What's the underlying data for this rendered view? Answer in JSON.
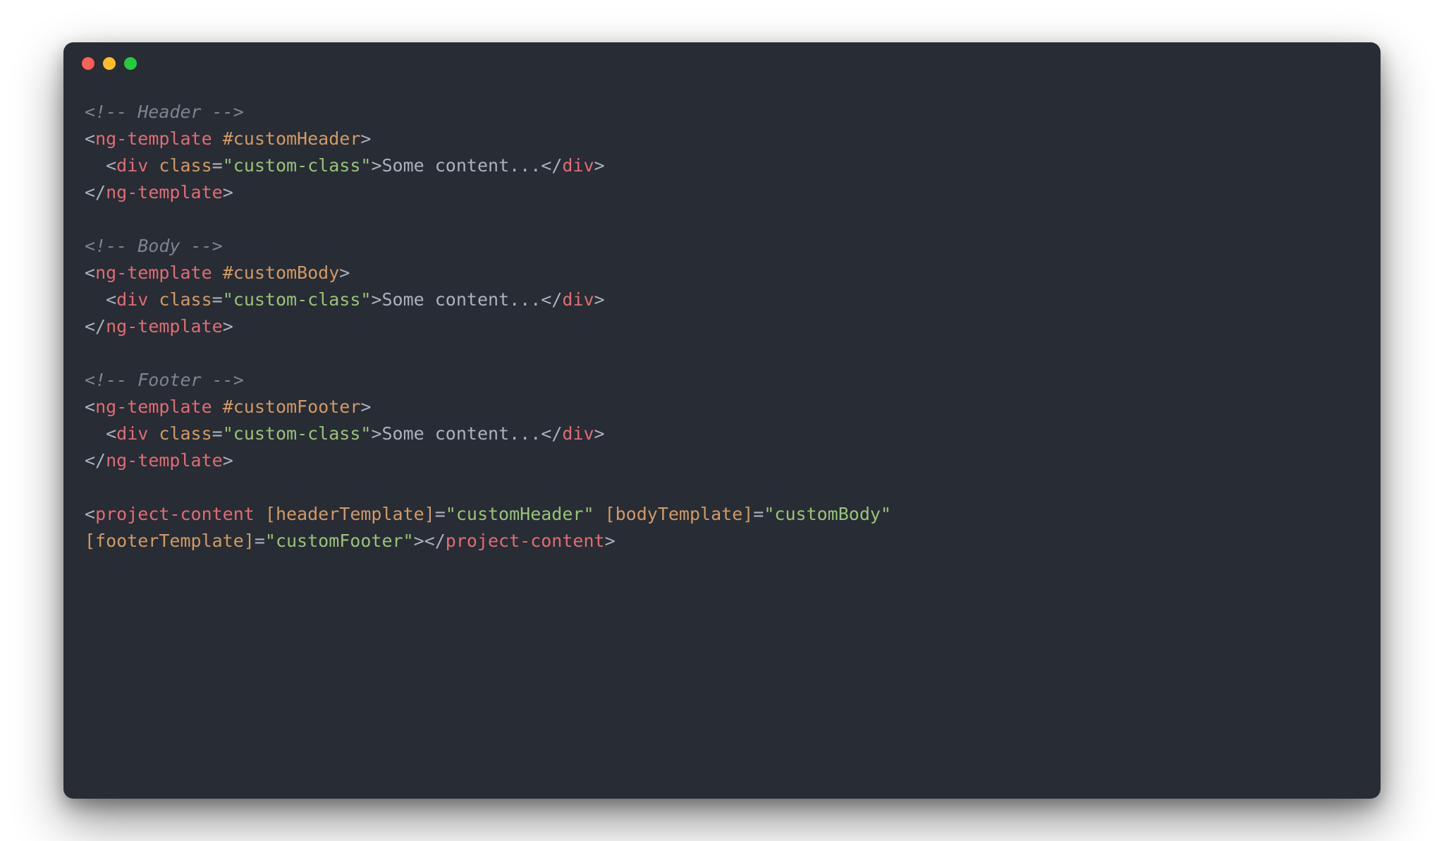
{
  "window": {
    "buttons": [
      "close",
      "minimize",
      "maximize"
    ],
    "editor_theme": "one-dark"
  },
  "code": {
    "lines": [
      {
        "type": "comment",
        "t": "<!-- Header -->"
      },
      {
        "type": "open_template",
        "tag": "ng-template",
        "ref": "#customHeader"
      },
      {
        "type": "div_line",
        "class_val": "custom-class",
        "content": "Some content..."
      },
      {
        "type": "close",
        "tag": "ng-template"
      },
      {
        "type": "blank"
      },
      {
        "type": "comment",
        "t": "<!-- Body -->"
      },
      {
        "type": "open_template",
        "tag": "ng-template",
        "ref": "#customBody"
      },
      {
        "type": "div_line",
        "class_val": "custom-class",
        "content": "Some content..."
      },
      {
        "type": "close",
        "tag": "ng-template"
      },
      {
        "type": "blank"
      },
      {
        "type": "comment",
        "t": "<!-- Footer -->"
      },
      {
        "type": "open_template",
        "tag": "ng-template",
        "ref": "#customFooter"
      },
      {
        "type": "div_line",
        "class_val": "custom-class",
        "content": "Some content..."
      },
      {
        "type": "close",
        "tag": "ng-template"
      },
      {
        "type": "blank"
      },
      {
        "type": "project_open",
        "tag": "project-content",
        "attrs": [
          {
            "name": "[headerTemplate]",
            "val": "customHeader"
          },
          {
            "name": "[bodyTemplate]",
            "val": "customBody"
          }
        ]
      },
      {
        "type": "project_close_line",
        "tag": "project-content",
        "attrs": [
          {
            "name": "[footerTemplate]",
            "val": "customFooter"
          }
        ]
      }
    ]
  }
}
